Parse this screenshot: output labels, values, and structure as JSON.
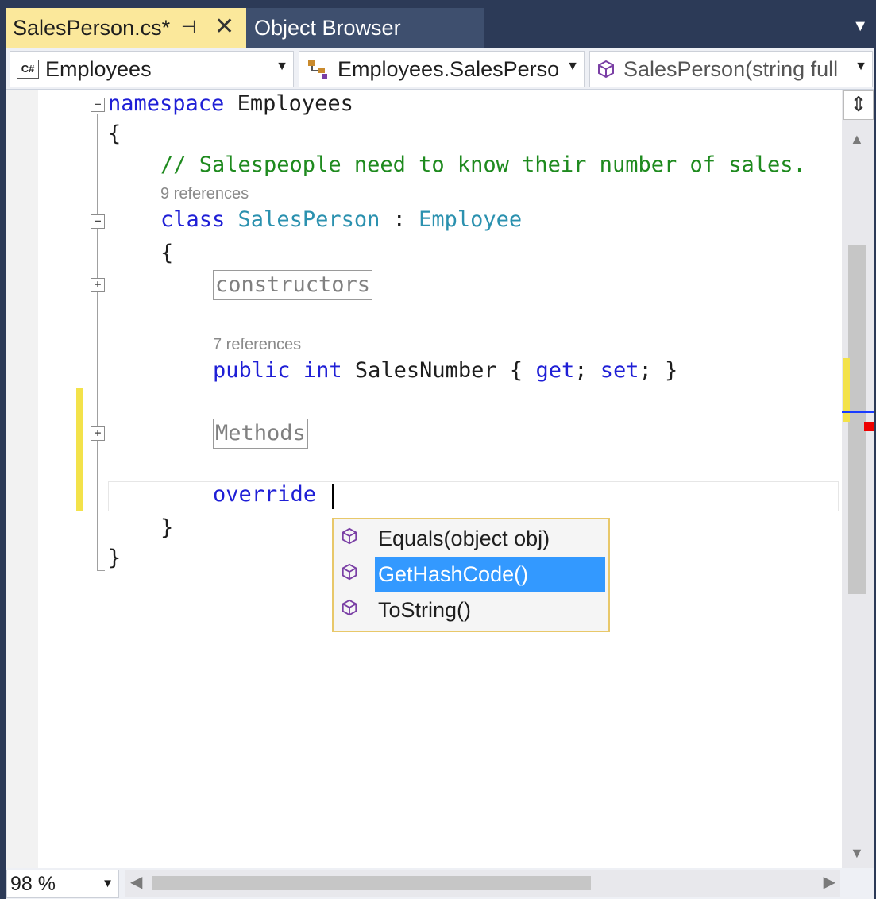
{
  "tabs": [
    {
      "label": "SalesPerson.cs*"
    },
    {
      "label": "Object Browser"
    }
  ],
  "tab_icons": {
    "pin": "pin-icon",
    "close": "close-icon",
    "overflow": "dropdown-icon"
  },
  "nav": {
    "project": "Employees",
    "project_icon": "C#",
    "type": "Employees.SalesPerso",
    "member": "SalesPerson(string full"
  },
  "code": {
    "line1_kw": "namespace",
    "line1_name": " Employees",
    "brace_open": "{",
    "comment": "// Salespeople need to know their number of sales.",
    "class_refs": "9 references",
    "class_kw": "class",
    "class_name": "SalesPerson",
    "colon": " : ",
    "base_name": "Employee",
    "class_brace_open": "{",
    "region_constructors": "constructors",
    "prop_refs": "7 references",
    "prop_public": "public",
    "prop_int": "int",
    "prop_name": " SalesNumber { ",
    "prop_get": "get",
    "prop_mid": "; ",
    "prop_set": "set",
    "prop_end": "; }",
    "region_methods": "Methods",
    "override_kw": "override",
    "class_brace_close": "}",
    "ns_brace_close": "}"
  },
  "completion": {
    "items": [
      {
        "label": "Equals(object obj)",
        "icon": "method-cube-icon"
      },
      {
        "label": "GetHashCode()",
        "icon": "method-cube-icon",
        "selected": true
      },
      {
        "label": "ToString()",
        "icon": "method-cube-icon"
      }
    ]
  },
  "status": {
    "zoom": "98 %"
  },
  "colors": {
    "keyword": "#1f1fd6",
    "type": "#2b91af",
    "comment": "#1e8a1e",
    "active_tab": "#fbe89b",
    "selection": "#3399ff"
  }
}
